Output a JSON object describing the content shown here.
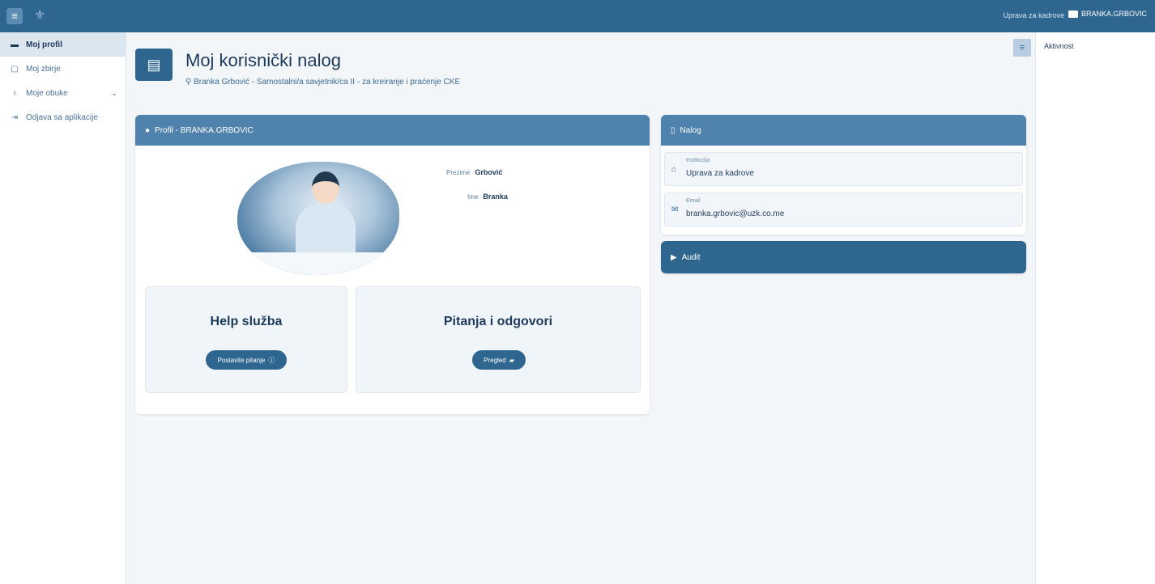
{
  "topbar": {
    "menu_icon": "hamburger-icon",
    "org_label": "Uprava za kadrove",
    "user_label": "BRANKA.GRBOVIC",
    "user_icon": "id-card-icon"
  },
  "sidebar": {
    "items": [
      {
        "label": "Moj profil",
        "icon": "id-card-icon"
      },
      {
        "label": "Moj zbirje",
        "icon": "clipboard-icon"
      },
      {
        "label": "Moje obuke",
        "icon": "bulb-icon"
      },
      {
        "label": "Odjava sa aplikacije",
        "icon": "logout-icon"
      }
    ]
  },
  "header": {
    "title": "Moj korisnički nalog",
    "subtitle": "Branka Grbović - Samostalni/a savjetnik/ca II - za kreiranje i praćenje CKE"
  },
  "profile": {
    "heading": "Profil - BRANKA.GRBOVIC",
    "surname_label": "Prezime",
    "surname_value": "Grbović",
    "name_label": "Ime",
    "name_value": "Branka"
  },
  "help": {
    "title": "Help služba",
    "button": "Postavite pitanje"
  },
  "faq": {
    "title": "Pitanja i odgovori",
    "button": "Pregled"
  },
  "account": {
    "heading": "Nalog",
    "institution_label": "Institucija",
    "institution_value": "Uprava za kadrove",
    "email_label": "Email",
    "email_value": "branka.grbovic@uzk.co.me"
  },
  "audit": {
    "heading": "Audit"
  },
  "right_panel": {
    "activity_label": "Aktivnost"
  },
  "colors": {
    "primary": "#2f6690",
    "header_card": "#4f83ad",
    "active_nav": "#dce6ef"
  }
}
